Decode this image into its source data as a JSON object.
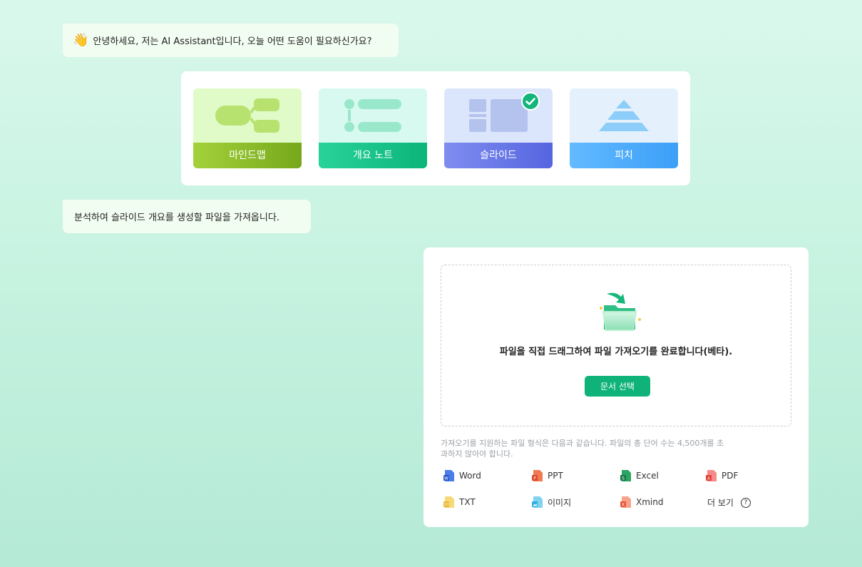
{
  "greeting": {
    "emoji": "👋",
    "text": "안녕하세요, 저는 AI Assistant입니다, 오늘 어떤 도움이 필요하신가요?"
  },
  "types": {
    "mindmap": "마인드맵",
    "outline": "개요 노트",
    "slide": "슬라이드",
    "pitch": "피치",
    "selected": "slide"
  },
  "info_message": "분석하여 슬라이드 개요를 생성할 파일을 가져옵니다.",
  "import": {
    "drop_text": "파일을 직접 드래그하여 파일 가져오기를 완료합니다(베타).",
    "select_button": "문서 선택",
    "supported_note": "가져오기를 지원하는 파일 형식은 다음과 같습니다. 파일의 총 단어 수는 4,500개를 초과하지 않아야 합니다.",
    "formats": {
      "word": "Word",
      "ppt": "PPT",
      "excel": "Excel",
      "pdf": "PDF",
      "txt": "TXT",
      "image": "이미지",
      "xmind": "Xmind"
    },
    "more": "더 보기",
    "more_icon": "?"
  },
  "colors": {
    "accent_green": "#0fb37a",
    "mindmap": "#8bc22a",
    "outline": "#14c488",
    "slide": "#6676e8",
    "pitch": "#4aaaf9"
  }
}
